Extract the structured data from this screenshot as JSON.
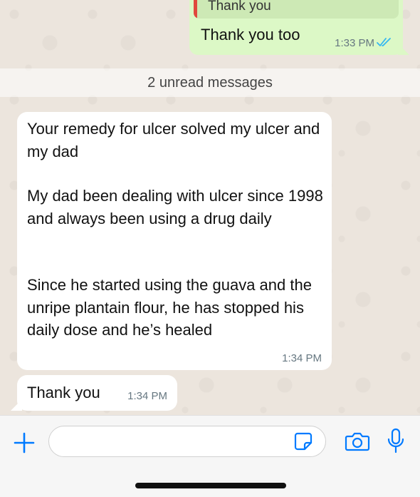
{
  "conversation": {
    "outgoing": {
      "quoted_text": "Thank you",
      "text": "Thank you too",
      "time": "1:33 PM"
    },
    "unread_banner": "2 unread messages",
    "incoming": [
      {
        "paragraphs": [
          "Your remedy for ulcer solved my ulcer and my dad",
          "My dad been dealing with ulcer since 1998 and always been using a drug daily",
          "Since he started using the guava and the unripe plantain flour, he has stopped his daily dose and he’s healed"
        ],
        "time": "1:34 PM"
      },
      {
        "text": "Thank you",
        "time": "1:34 PM"
      }
    ]
  },
  "input_bar": {
    "placeholder": "",
    "icons": [
      "plus-icon",
      "sticker-icon",
      "camera-icon",
      "microphone-icon"
    ]
  },
  "colors": {
    "outgoing_bubble": "#dcf8c6",
    "incoming_bubble": "#ffffff",
    "read_ticks": "#34b7f1",
    "accent": "#007aff"
  }
}
